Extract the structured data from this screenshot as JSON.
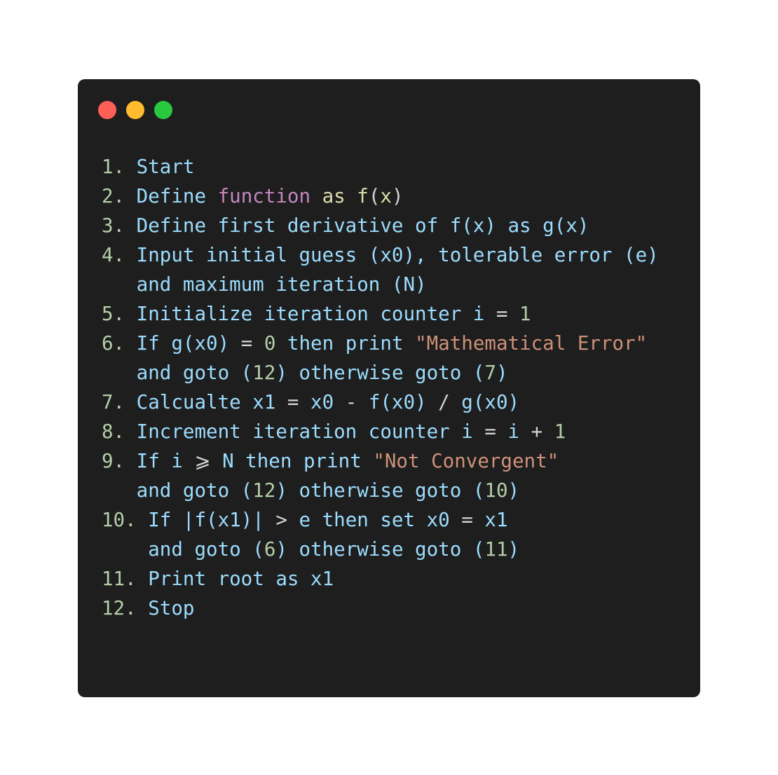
{
  "window": {
    "controls": [
      "close",
      "minimize",
      "maximize"
    ],
    "colors": {
      "close": "#ff5f57",
      "minimize": "#febc2e",
      "maximize": "#28c840",
      "background": "#1e1e1e"
    }
  },
  "code": {
    "lines": [
      {
        "num": "1.",
        "segments": [
          {
            "t": "Start"
          }
        ]
      },
      {
        "num": "2.",
        "segments": [
          {
            "t": "Define "
          },
          {
            "kw": "function"
          },
          {
            "t": " "
          },
          {
            "fn": "as"
          },
          {
            "t": " "
          },
          {
            "fn": "f"
          },
          {
            "op": "("
          },
          {
            "fn": "x"
          },
          {
            "op": ")"
          }
        ]
      },
      {
        "num": "3.",
        "segments": [
          {
            "t": "Define first derivative of f(x) as g(x)"
          }
        ]
      },
      {
        "num": "4.",
        "segments": [
          {
            "t": "Input initial guess (x0), tolerable error (e)"
          }
        ]
      },
      {
        "num": "",
        "cont": true,
        "segments": [
          {
            "t": "and maximum iteration (N)"
          }
        ]
      },
      {
        "num": "5.",
        "segments": [
          {
            "t": "Initialize iteration counter i "
          },
          {
            "op": "="
          },
          {
            "t": " "
          },
          {
            "lit": "1"
          }
        ]
      },
      {
        "num": "6.",
        "segments": [
          {
            "t": "If g(x0) "
          },
          {
            "op": "="
          },
          {
            "t": " "
          },
          {
            "lit": "0"
          },
          {
            "t": " then print "
          },
          {
            "str": "\"Mathematical Error\""
          }
        ]
      },
      {
        "num": "",
        "cont": true,
        "segments": [
          {
            "t": "and goto ("
          },
          {
            "lit": "12"
          },
          {
            "t": ") otherwise goto ("
          },
          {
            "lit": "7"
          },
          {
            "t": ")"
          }
        ]
      },
      {
        "num": "7.",
        "segments": [
          {
            "t": "Calcualte x1 "
          },
          {
            "op": "="
          },
          {
            "t": " x0 "
          },
          {
            "op": "-"
          },
          {
            "t": " f(x0) "
          },
          {
            "op": "/"
          },
          {
            "t": " g(x0)"
          }
        ]
      },
      {
        "num": "8.",
        "segments": [
          {
            "t": "Increment iteration counter i "
          },
          {
            "op": "="
          },
          {
            "t": " i "
          },
          {
            "op": "+"
          },
          {
            "t": " "
          },
          {
            "lit": "1"
          }
        ]
      },
      {
        "num": "9.",
        "segments": [
          {
            "t": "If i "
          },
          {
            "op": "⩾"
          },
          {
            "t": " N then print "
          },
          {
            "str": "\"Not Convergent\""
          }
        ]
      },
      {
        "num": "",
        "cont": true,
        "segments": [
          {
            "t": "and goto ("
          },
          {
            "lit": "12"
          },
          {
            "t": ") otherwise goto ("
          },
          {
            "lit": "10"
          },
          {
            "t": ")"
          }
        ]
      },
      {
        "num": "10.",
        "segments": [
          {
            "t": "If |f(x1)| "
          },
          {
            "op": ">"
          },
          {
            "t": " e then set x0 "
          },
          {
            "op": "="
          },
          {
            "t": " x1"
          }
        ]
      },
      {
        "num": "",
        "cont": true,
        "wide": true,
        "segments": [
          {
            "t": "and goto ("
          },
          {
            "lit": "6"
          },
          {
            "t": ") otherwise goto ("
          },
          {
            "lit": "11"
          },
          {
            "t": ")"
          }
        ]
      },
      {
        "num": "11.",
        "segments": [
          {
            "t": "Print root as x1"
          }
        ]
      },
      {
        "num": "12.",
        "segments": [
          {
            "t": "Stop"
          }
        ]
      }
    ]
  }
}
